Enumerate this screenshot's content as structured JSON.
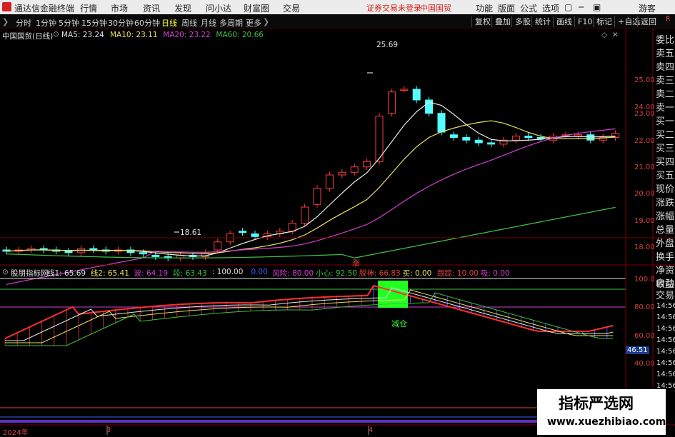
{
  "app": {
    "title": "通达信金融终端"
  },
  "menu": {
    "items": [
      "行情",
      "市场",
      "资讯",
      "发现",
      "问小达",
      "财富圈",
      "交易"
    ],
    "login_status": "证券交易未登录",
    "stock_name": "中国国贸",
    "right_items": [
      "功能",
      "版面",
      "公式",
      "选项"
    ],
    "user": "游客"
  },
  "periods": {
    "items": [
      "分时",
      "1分钟",
      "5分钟",
      "15分钟",
      "30分钟",
      "60分钟",
      "日线",
      "周线",
      "月线",
      "多周期",
      "更多"
    ],
    "active": "日线"
  },
  "toolbar": {
    "buttons": [
      "复权",
      "叠加",
      "多股",
      "统计",
      "画线",
      "F10",
      "标记",
      "+自选",
      "返回"
    ]
  },
  "price_chart": {
    "title": "中国国贸(日线)",
    "ma_labels": [
      {
        "text": "MA5: 23.24",
        "color": "#e0e0e0"
      },
      {
        "text": "MA10: 23.11",
        "color": "#e8e060"
      },
      {
        "text": "MA20: 23.22",
        "color": "#d040d0"
      },
      {
        "text": "MA60: 20.66",
        "color": "#40c040"
      }
    ],
    "high_label": "25.69",
    "low_label": "18.61",
    "y_ticks": [
      "25.00",
      "24.00",
      "23.00",
      "22.00",
      "21.00",
      "20.00",
      "19.00",
      "18.00"
    ],
    "zhang": "涨",
    "corner": "R"
  },
  "indicator": {
    "name": "股朋指标网",
    "values": [
      {
        "text": "线1: 65.69",
        "color": "#e0e0e0"
      },
      {
        "text": "线2: 65.41",
        "color": "#e8e060"
      },
      {
        "text": "波: 64.19",
        "color": "#d040d0"
      },
      {
        "text": "段: 63.43",
        "color": "#40c040"
      },
      {
        "text": ": 100.00",
        "color": "#e0e0e0"
      },
      {
        "text": "0.00",
        "color": "#4060ff"
      },
      {
        "text": "风险: 80.00",
        "color": "#d040d0"
      },
      {
        "text": "小心: 92.50",
        "color": "#40c040"
      },
      {
        "text": "脱神: 66.83",
        "color": "#e04040"
      },
      {
        "text": "买: 0.00",
        "color": "#e8e060"
      },
      {
        "text": "跟踪: 10.00",
        "color": "#e04040"
      },
      {
        "text": "吸: 0.00",
        "color": "#d040d0"
      }
    ],
    "signal": "减仓",
    "y_ticks": [
      "100.0",
      "80.00",
      "60.00",
      "40.00"
    ],
    "current": "46.51"
  },
  "right_panel": {
    "labels": [
      "委比",
      "卖五",
      "卖四",
      "卖三",
      "卖二",
      "卖一",
      "买一",
      "买二",
      "买三",
      "买四",
      "买五",
      "现价",
      "涨跌",
      "涨幅",
      "总量",
      "外盘",
      "换手",
      "净资",
      "收益",
      "自动",
      "交易"
    ],
    "times": [
      "14:56",
      "14:56",
      "14:56",
      "14:56",
      "14:56",
      "14:56",
      "14:56",
      "14:56",
      "14:56",
      "14:56",
      "14:56",
      "14:56"
    ]
  },
  "x_axis": {
    "labels": [
      "2024年",
      "3",
      "4"
    ]
  },
  "watermark": {
    "line1": "指标严选网",
    "line2": "www.xuezhibiao.com"
  },
  "colors": {
    "up": "#ff3c3c",
    "down": "#54ffff",
    "accent": "#d42020"
  }
}
